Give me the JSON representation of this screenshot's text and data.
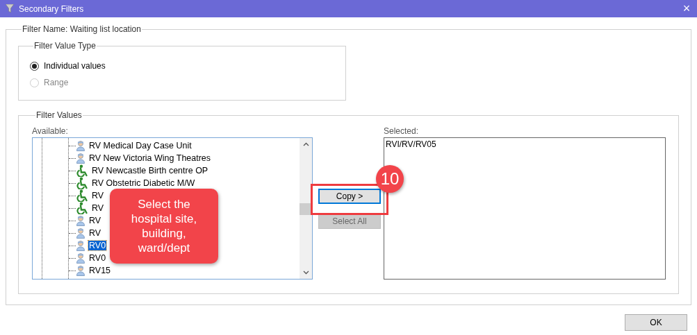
{
  "window": {
    "title": "Secondary Filters",
    "close": "×"
  },
  "filter_name": "Filter Name: Waiting list location",
  "value_type": {
    "title": "Filter Value Type",
    "options": [
      {
        "label": "Individual values",
        "selected": true,
        "disabled": false
      },
      {
        "label": "Range",
        "selected": false,
        "disabled": true
      }
    ]
  },
  "filter_values": {
    "title": "Filter Values",
    "available_label": "Available:",
    "selected_label": "Selected:",
    "tree_items": [
      {
        "label": "RV Medical Day Case Unit",
        "kind": "staff",
        "selected": false
      },
      {
        "label": "RV New Victoria Wing Theatres",
        "kind": "staff",
        "selected": false
      },
      {
        "label": "RV Newcastle Birth centre OP",
        "kind": "accessible",
        "selected": false
      },
      {
        "label": "RV Obstetric Diabetic M/W",
        "kind": "accessible",
        "selected": false
      },
      {
        "label": "RV",
        "kind": "accessible",
        "selected": false
      },
      {
        "label": "RV",
        "kind": "accessible",
        "selected": false
      },
      {
        "label": "RV",
        "kind": "staff",
        "selected": false
      },
      {
        "label": "RV",
        "kind": "staff",
        "selected": false
      },
      {
        "label": "RV0",
        "kind": "staff",
        "selected": true
      },
      {
        "label": "RV0",
        "kind": "staff",
        "selected": false
      },
      {
        "label": "RV15",
        "kind": "staff",
        "selected": false
      }
    ],
    "buttons": [
      {
        "label": "Copy >",
        "disabled": false
      },
      {
        "label": "Select All",
        "disabled": true
      }
    ],
    "selected_items": [
      "RVI/RV/RV05"
    ]
  },
  "callout": {
    "text": "Select the hospital site, building, ward/dept",
    "step": "10"
  },
  "ok_button": "OK"
}
